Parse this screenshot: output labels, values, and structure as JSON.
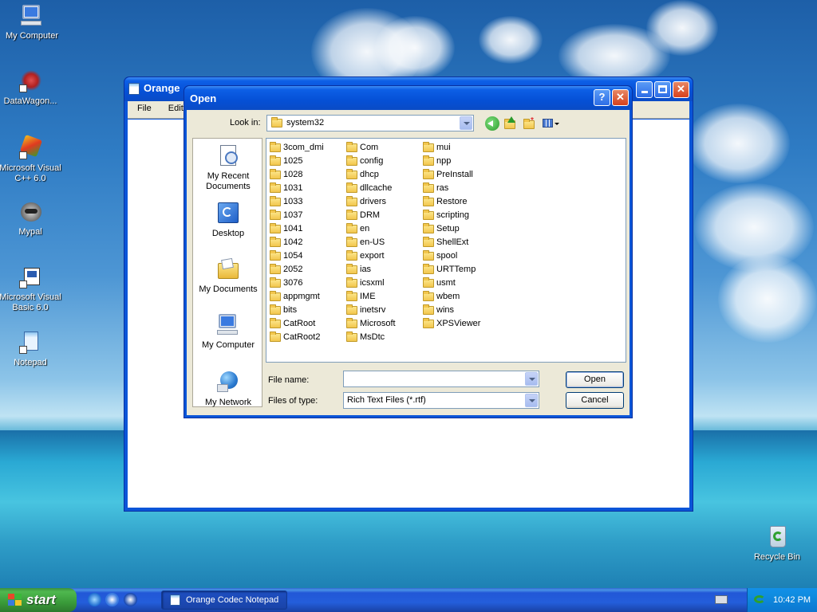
{
  "desktop": {
    "icons": [
      {
        "label": "My Computer"
      },
      {
        "label": "DataWagon..."
      },
      {
        "label": "Microsoft Visual C++ 6.0"
      },
      {
        "label": "Mypal"
      },
      {
        "label": "Microsoft Visual Basic 6.0"
      },
      {
        "label": "Notepad"
      },
      {
        "label": "Recycle Bin"
      }
    ]
  },
  "notepad": {
    "title": "Orange Codec Notepad",
    "title_visible": "Orange",
    "menu": [
      "File",
      "Edit"
    ]
  },
  "dialog": {
    "title": "Open",
    "look_in_label": "Look in:",
    "look_in_value": "system32",
    "places": [
      {
        "label": "My Recent Documents"
      },
      {
        "label": "Desktop"
      },
      {
        "label": "My Documents"
      },
      {
        "label": "My Computer"
      },
      {
        "label": "My Network"
      }
    ],
    "files_col1": [
      "3com_dmi",
      "1025",
      "1028",
      "1031",
      "1033",
      "1037",
      "1041",
      "1042",
      "1054",
      "2052",
      "3076",
      "appmgmt",
      "bits",
      "CatRoot",
      "CatRoot2"
    ],
    "files_col2": [
      "Com",
      "config",
      "dhcp",
      "dllcache",
      "drivers",
      "DRM",
      "en",
      "en-US",
      "export",
      "ias",
      "icsxml",
      "IME",
      "inetsrv",
      "Microsoft",
      "MsDtc"
    ],
    "files_col3": [
      "mui",
      "npp",
      "PreInstall",
      "ras",
      "Restore",
      "scripting",
      "Setup",
      "ShellExt",
      "spool",
      "URTTemp",
      "usmt",
      "wbem",
      "wins",
      "XPSViewer"
    ],
    "file_name_label": "File name:",
    "file_name_value": "",
    "file_type_label": "Files of type:",
    "file_type_value": "Rich Text Files (*.rtf)",
    "open_label": "Open",
    "cancel_label": "Cancel"
  },
  "taskbar": {
    "start_label": "start",
    "task_label": "Orange Codec Notepad",
    "clock": "10:42 PM"
  }
}
